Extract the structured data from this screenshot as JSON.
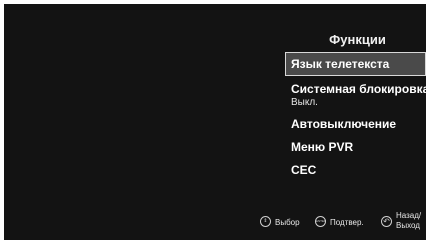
{
  "menu": {
    "title": "Функции",
    "items": [
      {
        "label": "Язык телетекста",
        "selected": true
      },
      {
        "label": "Системная блокировка",
        "sub_value": "Выкл."
      },
      {
        "label": "Автовыключение"
      },
      {
        "label": "Меню PVR"
      },
      {
        "label": "CEC"
      }
    ]
  },
  "hints": {
    "select": {
      "icon": "up-down-navigation-icon",
      "icon_glyph": "⇕",
      "label": "Выбор"
    },
    "confirm": {
      "icon": "enter-icon",
      "icon_glyph": "ENTER",
      "label": "Подтвер."
    },
    "back": {
      "icon": "return-icon",
      "icon_glyph": "↶",
      "label_line1": "Назад/",
      "label_line2": "Выход"
    }
  },
  "colors": {
    "screen_background": "#131313",
    "selection_background": "#4a4a4a",
    "selection_border": "#d8d8d8",
    "text": "#ffffff"
  }
}
